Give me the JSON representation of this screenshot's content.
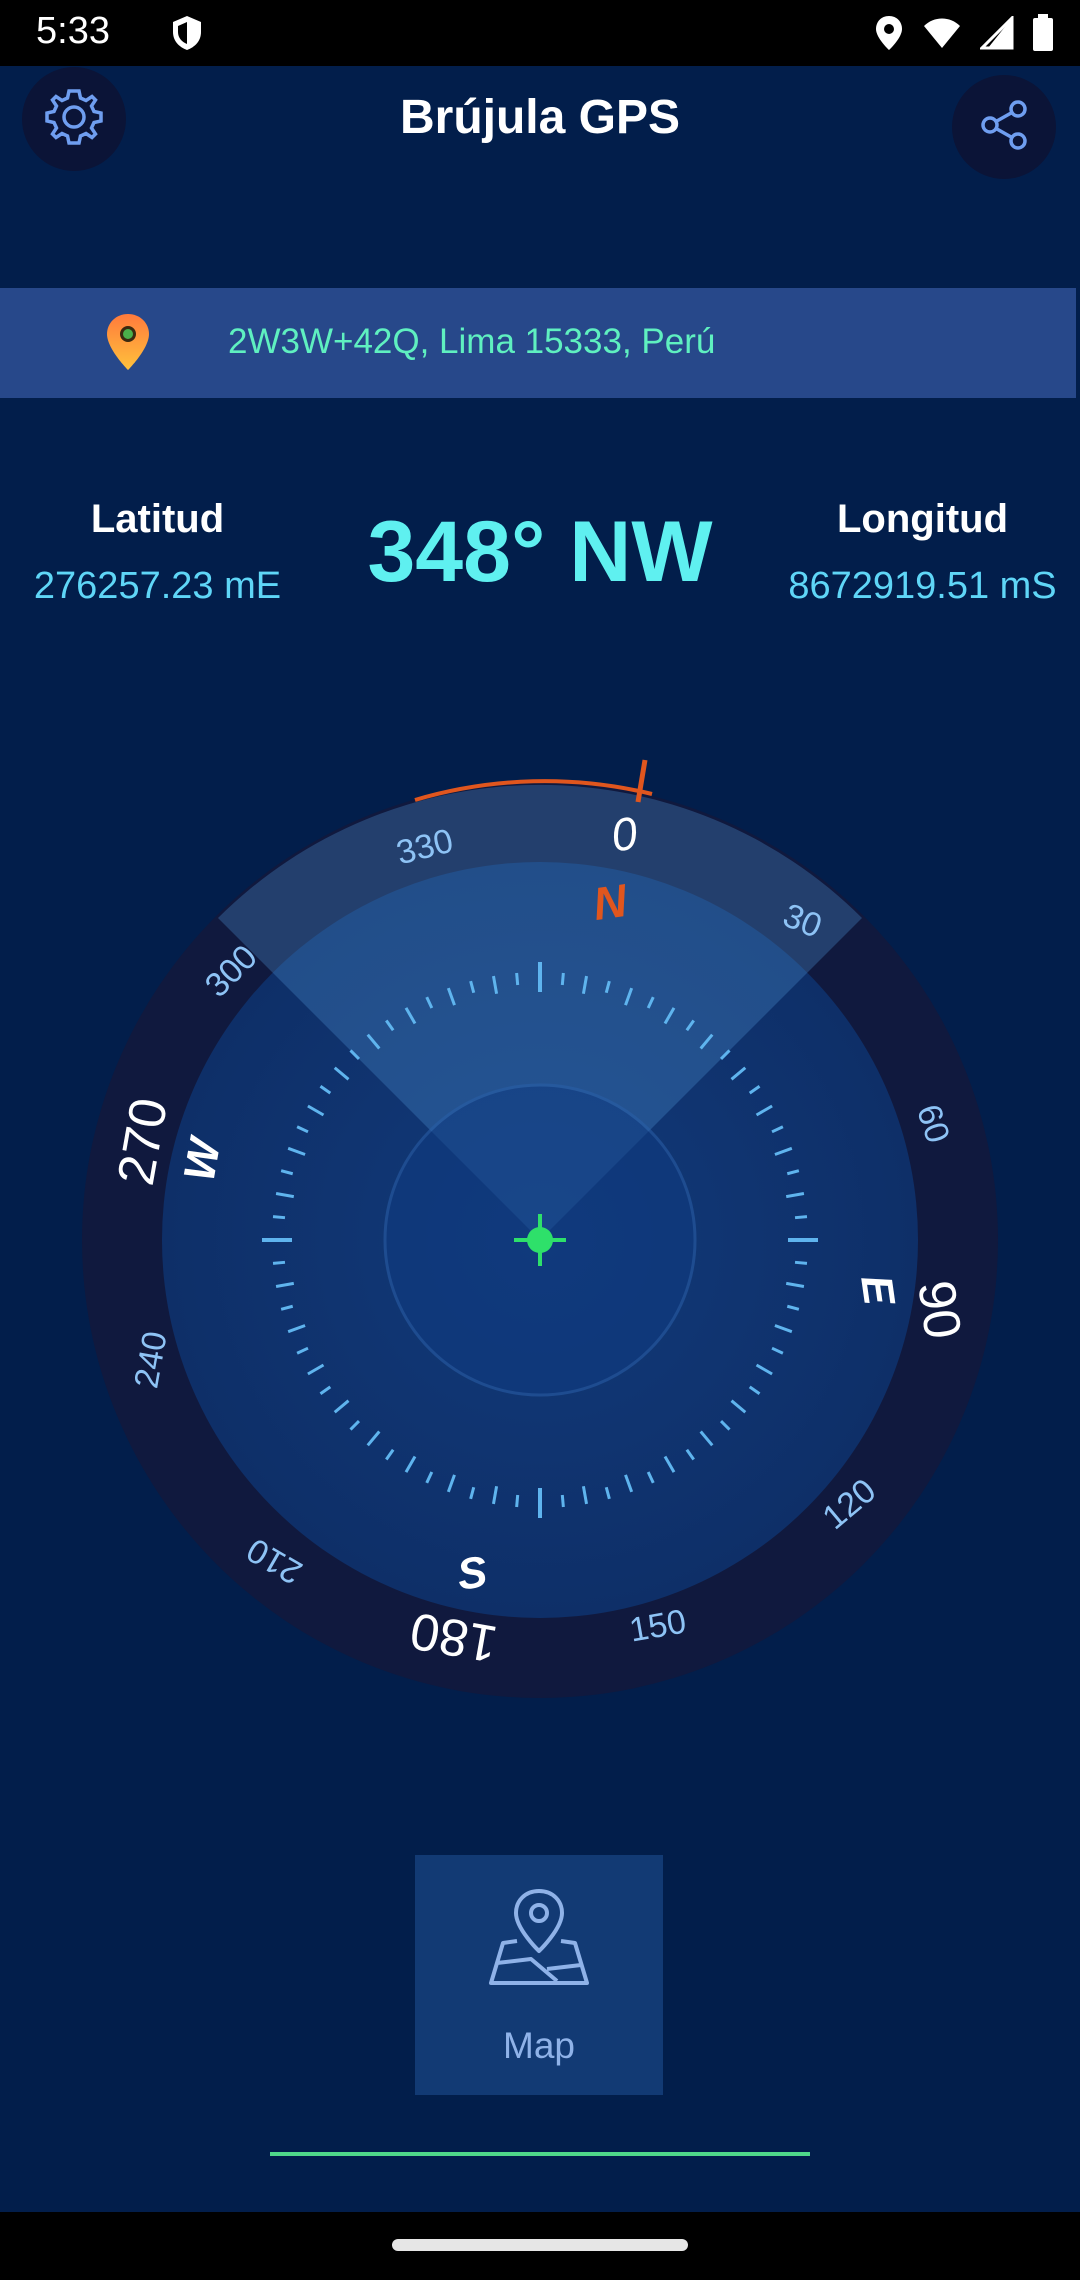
{
  "status_bar": {
    "time": "5:33"
  },
  "header": {
    "title": "Brújula GPS"
  },
  "address": {
    "text": "2W3W+42Q, Lima 15333, Perú"
  },
  "coords": {
    "lat_label": "Latitud",
    "lat_value": "276257.23 mE",
    "lon_label": "Longitud",
    "lon_value": "8672919.51 mS"
  },
  "heading": {
    "text": "348° NW"
  },
  "compass": {
    "degree_labels": [
      "0",
      "30",
      "60",
      "90",
      "120",
      "150",
      "180",
      "210",
      "240",
      "270",
      "300",
      "330"
    ],
    "cardinals": [
      "N",
      "E",
      "S",
      "W"
    ]
  },
  "bottom": {
    "map_label": "Map"
  },
  "colors": {
    "background": "#021e4b",
    "accent_cyan": "#5ff0f0",
    "address_text": "#5ff0c0",
    "north": "#e0561e",
    "center_dot": "#2ee06a"
  },
  "icons": [
    "gear-icon",
    "share-icon",
    "location-pin-icon",
    "map-pin-icon",
    "wifi-icon",
    "signal-icon",
    "battery-icon",
    "shield-icon"
  ]
}
